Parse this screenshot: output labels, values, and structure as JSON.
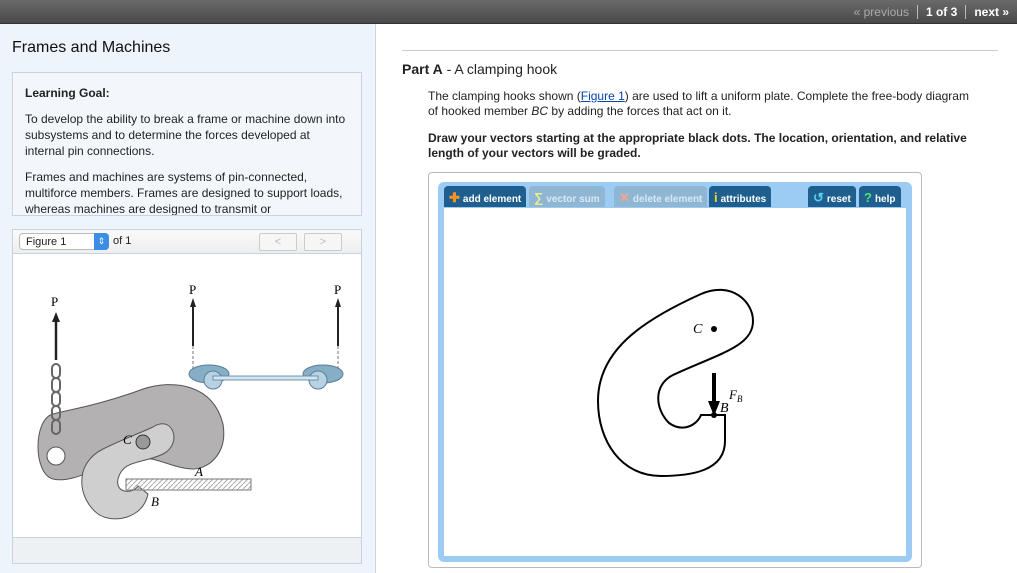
{
  "topnav": {
    "previous": "« previous",
    "position": "1 of 3",
    "next": "next »"
  },
  "left": {
    "title": "Frames and Machines",
    "goal_heading": "Learning Goal:",
    "goal_p1": "To develop the ability to break a frame or machine down into subsystems and to determine the forces developed at internal pin connections.",
    "goal_p2": "Frames and machines are systems of pin-connected, multiforce members. Frames are designed to support loads, whereas machines are designed to transmit or",
    "figure_select": "Figure 1",
    "figure_of": "of 1",
    "prev": "<",
    "next": ">",
    "figure_labels": {
      "p": "P",
      "c": "C",
      "a": "A",
      "b": "B"
    }
  },
  "part": {
    "label": "Part A",
    "title": "A clamping hook",
    "text_before": "The clamping hooks shown (",
    "link": "Figure 1",
    "text_after": ") are used to lift a uniform plate. Complete the free-body diagram of hooked member ",
    "member": "BC",
    "text_end": " by adding the forces that act on it.",
    "instruction": "Draw your vectors starting at the appropriate black dots. The location, orientation, and relative length of your vectors will be graded."
  },
  "toolbar": {
    "add": "add element",
    "sum": "vector sum",
    "delete": "delete element",
    "attributes": "attributes",
    "reset": "reset",
    "help": "help"
  },
  "canvas": {
    "c": "C",
    "b": "B",
    "fb": "F",
    "fb_sub": "B"
  }
}
